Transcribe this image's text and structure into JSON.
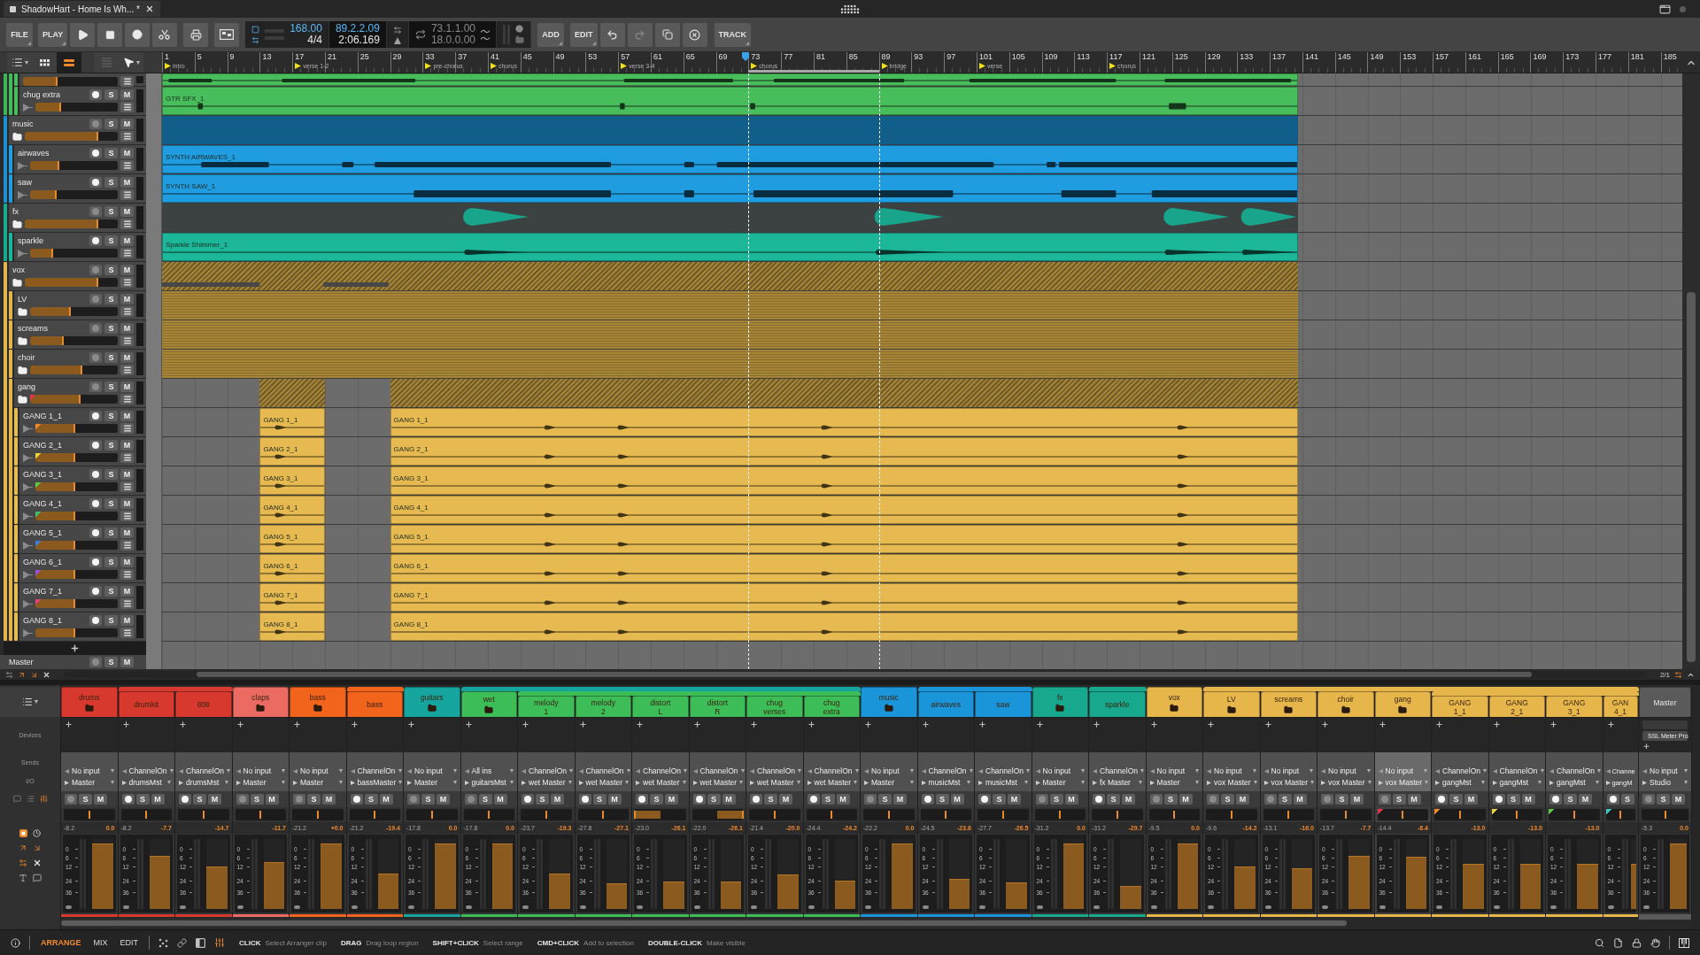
{
  "title_bar": {
    "tab": "ShadowHart - Home Is Wh... *"
  },
  "toolbar": {
    "file": "FILE",
    "play": "PLAY",
    "tempo": "168.00",
    "time_signature": "4/4",
    "position_bars": "89.2.2.09",
    "position_time": "2:06.169",
    "loop_start": "73.1.1.00",
    "loop_length": "18.0.0.00",
    "add": "ADD",
    "edit": "EDIT",
    "track": "TRACK"
  },
  "arranger": {
    "tools": [
      {
        "kind": "list",
        "selected": false
      },
      {
        "kind": "grid",
        "selected": false
      },
      {
        "kind": "lanes",
        "selected": true
      },
      {
        "kind": "stack",
        "selected": false
      },
      {
        "kind": "pointer",
        "selected": false
      }
    ],
    "ruler": [
      {
        "label": "1",
        "marker": "intro",
        "playhead": false,
        "loop": false
      },
      {
        "label": "5",
        "playhead": false,
        "loop": false
      },
      {
        "label": "9",
        "playhead": false,
        "loop": false
      },
      {
        "label": "13",
        "playhead": false,
        "loop": false
      },
      {
        "label": "17",
        "marker": "verse 1-2",
        "playhead": false,
        "loop": false
      },
      {
        "label": "21",
        "playhead": false,
        "loop": false
      },
      {
        "label": "25",
        "playhead": false,
        "loop": false
      },
      {
        "label": "29",
        "playhead": false,
        "loop": false
      },
      {
        "label": "33",
        "marker": "pre-chorus",
        "playhead": false,
        "loop": false
      },
      {
        "label": "37",
        "playhead": false,
        "loop": false
      },
      {
        "label": "41",
        "marker": "chorus",
        "playhead": false,
        "loop": false
      },
      {
        "label": "45",
        "playhead": false,
        "loop": false
      },
      {
        "label": "49",
        "playhead": false,
        "loop": false
      },
      {
        "label": "53",
        "playhead": false,
        "loop": false
      },
      {
        "label": "57",
        "marker": "verse 3-4",
        "playhead": false,
        "loop": false
      },
      {
        "label": "61",
        "playhead": false,
        "loop": false
      },
      {
        "label": "65",
        "playhead": false,
        "loop": false
      },
      {
        "label": "69",
        "playhead": false,
        "loop": false
      },
      {
        "label": "73",
        "marker": "chorus",
        "playhead": true,
        "loop": true
      },
      {
        "label": "77",
        "playhead": false,
        "loop": true
      },
      {
        "label": "81",
        "playhead": false,
        "loop": true
      },
      {
        "label": "85",
        "playhead": false,
        "loop": true
      },
      {
        "label": "89",
        "marker": "bridge",
        "playhead": false,
        "loop": false
      },
      {
        "label": "93",
        "playhead": false,
        "loop": false
      },
      {
        "label": "97",
        "playhead": false,
        "loop": false
      },
      {
        "label": "101",
        "marker": "verse",
        "playhead": false,
        "loop": false
      },
      {
        "label": "105",
        "playhead": false,
        "loop": false
      },
      {
        "label": "109",
        "playhead": false,
        "loop": false
      },
      {
        "label": "113",
        "playhead": false,
        "loop": false
      },
      {
        "label": "117",
        "marker": "chorus",
        "playhead": false,
        "loop": false
      },
      {
        "label": "121",
        "playhead": false,
        "loop": false
      },
      {
        "label": "125",
        "playhead": false,
        "loop": false
      },
      {
        "label": "129",
        "playhead": false,
        "loop": false
      },
      {
        "label": "133",
        "playhead": false,
        "loop": false
      },
      {
        "label": "137",
        "playhead": false,
        "loop": false
      },
      {
        "label": "141",
        "playhead": false,
        "loop": false
      },
      {
        "label": "145",
        "playhead": false,
        "loop": false
      },
      {
        "label": "149",
        "playhead": false,
        "loop": false
      },
      {
        "label": "153",
        "playhead": false,
        "loop": false
      },
      {
        "label": "157",
        "playhead": false,
        "loop": false
      },
      {
        "label": "161",
        "playhead": false,
        "loop": false
      },
      {
        "label": "165",
        "playhead": false,
        "loop": false
      },
      {
        "label": "169",
        "playhead": false,
        "loop": false
      },
      {
        "label": "173",
        "playhead": false,
        "loop": false
      },
      {
        "label": "177",
        "playhead": false,
        "loop": false
      },
      {
        "label": "181",
        "playhead": false,
        "loop": false
      },
      {
        "label": "185",
        "playhead": false,
        "loop": false
      }
    ],
    "tracks": [
      {
        "kind": "group",
        "color": "#3cb556",
        "children": [
          {
            "kind": "group",
            "color": "#43bb58",
            "children": [
              {
                "kind": "cut",
                "color": "#48bd5b",
                "level": 0.36
              },
              {
                "name": "chug extra",
                "kind": "audio",
                "color": "#48bd5b",
                "level": 0.31,
                "buttons": [
                  "S",
                  "M"
                ],
                "clips": [
                  {
                    "name": "GTR SFX_1"
                  }
                ]
              }
            ]
          }
        ]
      },
      {
        "name": "music",
        "kind": "group",
        "color": "#1b8fd2",
        "level": 0.79,
        "buttons": [
          "S",
          "M"
        ],
        "children": [
          {
            "name": "airwaves",
            "kind": "audio",
            "color": "#1f9de0",
            "level": 0.33,
            "buttons": [
              "S",
              "M"
            ],
            "clips": [
              {
                "name": "SYNTH AIRWAVES_1"
              }
            ]
          },
          {
            "name": "saw",
            "kind": "audio",
            "color": "#1f9de0",
            "level": 0.3,
            "buttons": [
              "S",
              "M"
            ],
            "clips": [
              {
                "name": "SYNTH SAW_1"
              }
            ]
          }
        ]
      },
      {
        "name": "fx",
        "kind": "group",
        "color": "#17a98f",
        "level": 0.79,
        "buttons": [
          "S",
          "M"
        ],
        "children": [
          {
            "name": "sparkle",
            "kind": "audio",
            "color": "#1cb799",
            "level": 0.26,
            "buttons": [
              "S",
              "M"
            ],
            "clips": [
              {
                "name": "Sparkle Shimmer_1"
              }
            ]
          }
        ]
      },
      {
        "name": "vox",
        "kind": "group",
        "color": "#e3b64c",
        "level": 0.79,
        "buttons": [
          "S",
          "M"
        ],
        "children": [
          {
            "name": "LV",
            "kind": "group",
            "color": "#e3b64c",
            "level": 0.46,
            "buttons": [
              "S",
              "M"
            ]
          },
          {
            "name": "screams",
            "kind": "group",
            "color": "#e3b64c",
            "level": 0.38,
            "buttons": [
              "S",
              "M"
            ]
          },
          {
            "name": "choir",
            "kind": "group",
            "color": "#e3b64c",
            "level": 0.6,
            "buttons": [
              "S",
              "M"
            ]
          },
          {
            "name": "gang",
            "kind": "group",
            "color": "#e3b64c",
            "level": 0.58,
            "buttons": [
              "S",
              "M"
            ],
            "tag": {
              "color": "#e2354c"
            },
            "children": [
              {
                "name": "GANG 1_1",
                "kind": "audio",
                "color": "#e6ba50",
                "level": 0.48,
                "buttons": [
                  "S",
                  "M"
                ],
                "tag": {
                  "color": "#f08a28"
                },
                "clips": [
                  {
                    "name": "GANG 1_1"
                  },
                  {
                    "name": "GANG 1_1"
                  }
                ]
              },
              {
                "name": "GANG 2_1",
                "kind": "audio",
                "color": "#e6ba50",
                "level": 0.48,
                "buttons": [
                  "S",
                  "M"
                ],
                "tag": {
                  "color": "#e6d43a"
                },
                "clips": [
                  {
                    "name": "GANG 2_1"
                  },
                  {
                    "name": "GANG 2_1"
                  }
                ]
              },
              {
                "name": "GANG 3_1",
                "kind": "audio",
                "color": "#e6ba50",
                "level": 0.48,
                "buttons": [
                  "S",
                  "M"
                ],
                "tag": {
                  "color": "#5cc644"
                },
                "clips": [
                  {
                    "name": "GANG 3_1"
                  },
                  {
                    "name": "GANG 3_1"
                  }
                ]
              },
              {
                "name": "GANG 4_1",
                "kind": "audio",
                "color": "#e6ba50",
                "level": 0.48,
                "buttons": [
                  "S",
                  "M"
                ],
                "tag": {
                  "color": "#38c06a"
                },
                "clips": [
                  {
                    "name": "GANG 4_1"
                  },
                  {
                    "name": "GANG 4_1"
                  }
                ]
              },
              {
                "name": "GANG 5_1",
                "kind": "audio",
                "color": "#e6ba50",
                "level": 0.48,
                "buttons": [
                  "S",
                  "M"
                ],
                "tag": {
                  "color": "#3f7fe0"
                },
                "clips": [
                  {
                    "name": "GANG 5_1"
                  },
                  {
                    "name": "GANG 5_1"
                  }
                ]
              },
              {
                "name": "GANG 6_1",
                "kind": "audio",
                "color": "#e6ba50",
                "level": 0.48,
                "buttons": [
                  "S",
                  "M"
                ],
                "tag": {
                  "color": "#9a4fe0"
                },
                "clips": [
                  {
                    "name": "GANG 6_1"
                  },
                  {
                    "name": "GANG 6_1"
                  }
                ]
              },
              {
                "name": "GANG 7_1",
                "kind": "audio",
                "color": "#e6ba50",
                "level": 0.48,
                "buttons": [
                  "S",
                  "M"
                ],
                "tag": {
                  "color": "#e0407a"
                },
                "clips": [
                  {
                    "name": "GANG 7_1"
                  },
                  {
                    "name": "GANG 7_1"
                  }
                ]
              },
              {
                "name": "GANG 8_1",
                "kind": "audio",
                "color": "#e6ba50",
                "level": 0.48,
                "buttons": [
                  "S",
                  "M"
                ],
                "clips": [
                  {
                    "name": "GANG 8_1"
                  },
                  {
                    "name": "GANG 8_1"
                  }
                ]
              }
            ]
          }
        ]
      }
    ],
    "master": {
      "name": "Master",
      "buttons": [
        "S",
        "M"
      ]
    },
    "zoom_readout": "2/1"
  },
  "mixer": {
    "sections": [
      "Devices",
      "Sends",
      "I/O"
    ],
    "strips": [
      {
        "name": "drums",
        "kind": "group",
        "color": "#d8392e",
        "selected": false,
        "input": "No input",
        "output": "Master",
        "buttons": [
          "S",
          "M"
        ],
        "pan": {
          "level": 0.5
        },
        "volume": "-8.2",
        "peak": "0.0",
        "level": 0.94,
        "scale": [
          "0",
          "6",
          "12",
          "24",
          "36"
        ],
        "children": [
          {
            "name": "drumkit",
            "kind": "audio",
            "color": "#d8392e",
            "selected": false,
            "input": "ChannelOn",
            "output": "drumsMst",
            "buttons": [
              "S",
              "M"
            ],
            "pan": {
              "level": 0.5
            },
            "volume": "-8.2",
            "peak": "-7.7",
            "level": 0.76,
            "scale": [
              "0",
              "6",
              "12",
              "24",
              "36"
            ]
          },
          {
            "name": "808",
            "kind": "audio",
            "color": "#d8392e",
            "selected": false,
            "input": "ChannelOn",
            "output": "drumsMst",
            "buttons": [
              "S",
              "M"
            ],
            "pan": {
              "level": 0.5
            },
            "peak": "-14.7",
            "level": 0.61,
            "scale": [
              "0",
              "6",
              "12",
              "24",
              "36"
            ]
          }
        ]
      },
      {
        "name": "claps",
        "kind": "group",
        "color": "#eb6b62",
        "selected": false,
        "input": "No input",
        "output": "Master",
        "buttons": [
          "S",
          "M"
        ],
        "pan": {
          "level": 0.5
        },
        "peak": "-11.7",
        "level": 0.67,
        "scale": [
          "0",
          "6",
          "12",
          "24",
          "36"
        ]
      },
      {
        "name": "bass",
        "kind": "group",
        "color": "#f2631b",
        "selected": false,
        "input": "No input",
        "output": "Master",
        "buttons": [
          "S",
          "M"
        ],
        "pan": {
          "level": 0.5
        },
        "volume": "-21.2",
        "peak": "+0.0",
        "level": 0.94,
        "scale": [
          "0",
          "6",
          "12",
          "24",
          "36"
        ],
        "children": [
          {
            "name": "bass",
            "kind": "audio",
            "color": "#f2631b",
            "selected": false,
            "input": "ChannelOn",
            "output": "bassMaster",
            "buttons": [
              "S",
              "M"
            ],
            "pan": {
              "level": 0.5
            },
            "volume": "-21.2",
            "peak": "-19.4",
            "level": 0.51,
            "scale": [
              "0",
              "6",
              "12",
              "24",
              "36"
            ]
          }
        ]
      },
      {
        "name": "guitars",
        "kind": "group",
        "color": "#16a59e",
        "selected": false,
        "input": "No input",
        "output": "Master",
        "buttons": [
          "S",
          "M"
        ],
        "pan": {
          "level": 0.5
        },
        "volume": "-17.8",
        "peak": "0.0",
        "level": 0.94,
        "scale": [
          "0",
          "6",
          "12",
          "24",
          "36"
        ],
        "children": [
          {
            "name": "wet",
            "kind": "group",
            "color": "#3dbd58",
            "selected": false,
            "input": "All ins",
            "output": "guitarsMst",
            "buttons": [
              "S",
              "M"
            ],
            "pan": {
              "level": 0.5
            },
            "volume": "-17.8",
            "peak": "0.0",
            "level": 0.94,
            "scale": [
              "0",
              "6",
              "12",
              "24",
              "36"
            ],
            "children": [
              {
                "name": "melody 1",
                "kind": "audio",
                "color": "#3dbd58",
                "selected": false,
                "input": "ChannelOn",
                "output": "wet Master",
                "buttons": [
                  "S",
                  "M"
                ],
                "pan": {
                  "level": 0.5
                },
                "volume": "-23.7",
                "peak": "-19.3",
                "level": 0.51,
                "scale": [
                  "0",
                  "6",
                  "12",
                  "24",
                  "36"
                ]
              },
              {
                "name": "melody 2",
                "kind": "audio",
                "color": "#3dbd58",
                "selected": false,
                "input": "ChannelOn",
                "output": "wet Master",
                "buttons": [
                  "S",
                  "M"
                ],
                "pan": {
                  "level": 0.5
                },
                "volume": "-27.8",
                "peak": "-27.1",
                "level": 0.37,
                "scale": [
                  "0",
                  "6",
                  "12",
                  "24",
                  "36"
                ]
              },
              {
                "name": "distort L",
                "kind": "audio",
                "color": "#3dbd58",
                "selected": false,
                "input": "ChannelOn",
                "output": "wet Master",
                "buttons": [
                  "S",
                  "M"
                ],
                "pan": {
                  "level": 0.0
                },
                "volume": "-23.0",
                "peak": "-26.1",
                "level": 0.39,
                "scale": [
                  "0",
                  "6",
                  "12",
                  "24",
                  "36"
                ]
              },
              {
                "name": "distort R",
                "kind": "audio",
                "color": "#3dbd58",
                "selected": false,
                "input": "ChannelOn",
                "output": "wet Master",
                "buttons": [
                  "S",
                  "M"
                ],
                "pan": {
                  "level": 1.0
                },
                "volume": "-22.0",
                "peak": "-26.1",
                "level": 0.39,
                "scale": [
                  "0",
                  "6",
                  "12",
                  "24",
                  "36"
                ]
              },
              {
                "name": "chug verses",
                "kind": "audio",
                "color": "#3dbd58",
                "selected": false,
                "input": "ChannelOn",
                "output": "wet Master",
                "buttons": [
                  "S",
                  "M"
                ],
                "pan": {
                  "level": 0.5
                },
                "volume": "-21.4",
                "peak": "-20.0",
                "level": 0.5,
                "scale": [
                  "0",
                  "6",
                  "12",
                  "24",
                  "36"
                ]
              },
              {
                "name": "chug extra",
                "kind": "audio",
                "color": "#3dbd58",
                "selected": false,
                "input": "ChannelOn",
                "output": "wet Master",
                "buttons": [
                  "S",
                  "M"
                ],
                "pan": {
                  "level": 0.5
                },
                "volume": "-24.4",
                "peak": "-24.2",
                "level": 0.41,
                "scale": [
                  "0",
                  "6",
                  "12",
                  "24",
                  "36"
                ]
              }
            ]
          }
        ]
      },
      {
        "name": "music",
        "kind": "group",
        "color": "#1b95d9",
        "selected": false,
        "input": "No input",
        "output": "Master",
        "buttons": [
          "S",
          "M"
        ],
        "pan": {
          "level": 0.5
        },
        "volume": "-22.2",
        "peak": "0.0",
        "level": 0.94,
        "scale": [
          "0",
          "6",
          "12",
          "24",
          "36"
        ],
        "children": [
          {
            "name": "airwaves",
            "kind": "audio",
            "color": "#1b95d9",
            "selected": false,
            "input": "ChannelOn",
            "output": "musicMst",
            "buttons": [
              "S",
              "M"
            ],
            "pan": {
              "level": 0.5
            },
            "volume": "-24.5",
            "peak": "-23.6",
            "level": 0.43,
            "scale": [
              "0",
              "6",
              "12",
              "24",
              "36"
            ]
          },
          {
            "name": "saw",
            "kind": "audio",
            "color": "#1b95d9",
            "selected": false,
            "input": "ChannelOn",
            "output": "musicMst",
            "buttons": [
              "S",
              "M"
            ],
            "pan": {
              "level": 0.5
            },
            "volume": "-27.7",
            "peak": "-26.5",
            "level": 0.38,
            "scale": [
              "0",
              "6",
              "12",
              "24",
              "36"
            ]
          }
        ]
      },
      {
        "name": "fx",
        "kind": "group",
        "color": "#17a88d",
        "selected": false,
        "input": "No input",
        "output": "Master",
        "buttons": [
          "S",
          "M"
        ],
        "pan": {
          "level": 0.5
        },
        "volume": "-31.2",
        "peak": "0.0",
        "level": 0.94,
        "scale": [
          "0",
          "6",
          "12",
          "24",
          "36"
        ],
        "children": [
          {
            "name": "sparkle",
            "kind": "audio",
            "color": "#17a88d",
            "selected": false,
            "input": "ChannelOn",
            "output": "fx Master",
            "buttons": [
              "S",
              "M"
            ],
            "pan": {
              "level": 0.5
            },
            "volume": "-31.2",
            "peak": "-29.7",
            "level": 0.33,
            "scale": [
              "0",
              "6",
              "12",
              "24",
              "36"
            ]
          }
        ]
      },
      {
        "name": "vox",
        "kind": "group",
        "color": "#e6b64b",
        "selected": false,
        "input": "No input",
        "output": "Master",
        "buttons": [
          "S",
          "M"
        ],
        "pan": {
          "level": 0.5
        },
        "volume": "-9.5",
        "peak": "0.0",
        "level": 0.94,
        "scale": [
          "0",
          "6",
          "12",
          "24",
          "36"
        ],
        "children": [
          {
            "name": "LV",
            "kind": "group",
            "color": "#e6b64b",
            "selected": false,
            "input": "No input",
            "output": "vox Master",
            "buttons": [
              "S",
              "M"
            ],
            "pan": {
              "level": 0.5
            },
            "volume": "-9.6",
            "peak": "-14.2",
            "level": 0.61,
            "scale": [
              "0",
              "6",
              "12",
              "24",
              "36"
            ]
          },
          {
            "name": "screams",
            "kind": "group",
            "color": "#e6b64b",
            "selected": false,
            "input": "No input",
            "output": "vox Master",
            "buttons": [
              "S",
              "M"
            ],
            "pan": {
              "level": 0.5
            },
            "volume": "-13.1",
            "peak": "-16.0",
            "level": 0.58,
            "scale": [
              "0",
              "6",
              "12",
              "24",
              "36"
            ]
          },
          {
            "name": "choir",
            "kind": "group",
            "color": "#e6b64b",
            "selected": false,
            "input": "No input",
            "output": "vox Master",
            "buttons": [
              "S",
              "M"
            ],
            "pan": {
              "level": 0.5
            },
            "volume": "-13.7",
            "peak": "-7.7",
            "level": 0.76,
            "scale": [
              "0",
              "6",
              "12",
              "24",
              "36"
            ]
          },
          {
            "name": "gang",
            "kind": "group",
            "color": "#e6b64b",
            "selected": true,
            "input": "No input",
            "output": "vox Master",
            "buttons": [
              "S",
              "M"
            ],
            "pan": {
              "level": 0.5
            },
            "volume": "-14.4",
            "peak": "-8.4",
            "level": 0.75,
            "scale": [
              "0",
              "6",
              "12",
              "24",
              "36"
            ],
            "tag": {
              "color": "#e2354c"
            },
            "children": [
              {
                "name": "GANG 1_1",
                "kind": "audio",
                "color": "#e6b64b",
                "selected": false,
                "input": "ChannelOn",
                "output": "gangMst",
                "buttons": [
                  "S",
                  "M"
                ],
                "pan": {
                  "level": 0.5
                },
                "peak": "-13.0",
                "level": 0.64,
                "scale": [
                  "0",
                  "6",
                  "12",
                  "24",
                  "36"
                ],
                "tag": {
                  "color": "#f08a28"
                }
              },
              {
                "name": "GANG 2_1",
                "kind": "audio",
                "color": "#e6b64b",
                "selected": false,
                "input": "ChannelOn",
                "output": "gangMst",
                "buttons": [
                  "S",
                  "M"
                ],
                "pan": {
                  "level": 0.5
                },
                "peak": "-13.0",
                "level": 0.64,
                "scale": [
                  "0",
                  "6",
                  "12",
                  "24",
                  "36"
                ],
                "tag": {
                  "color": "#e6d43a"
                }
              },
              {
                "name": "GANG 3_1",
                "kind": "audio",
                "color": "#e6b64b",
                "selected": false,
                "input": "ChannelOn",
                "output": "gangMst",
                "buttons": [
                  "S",
                  "M"
                ],
                "pan": {
                  "level": 0.5
                },
                "peak": "-13.0",
                "level": 0.64,
                "scale": [
                  "0",
                  "6",
                  "12",
                  "24",
                  "36"
                ],
                "tag": {
                  "color": "#5cc644"
                }
              },
              {
                "name": "GAN 4_1",
                "kind": "cut",
                "color": "#e6b64b",
                "selected": false,
                "input": "Channe",
                "output": "gangM",
                "buttons": [
                  "S"
                ],
                "pan": {
                  "level": 0.5
                },
                "level": 0.64,
                "scale": [
                  "0",
                  "6",
                  "12",
                  "24",
                  "36"
                ],
                "tag": {
                  "color": "#38c6c0"
                }
              }
            ]
          }
        ]
      }
    ],
    "master": {
      "name": "Master",
      "devices": [
        {
          "enabled": false
        },
        {
          "name": "SSL Meter Pro",
          "enabled": true
        }
      ],
      "input": "No input",
      "output": "Studio",
      "buttons": [
        "S",
        "M"
      ],
      "pan": {
        "level": 0.5
      },
      "volume": "-5.3",
      "peak": "0.0",
      "level": 0.94,
      "scale": [
        "0",
        "6",
        "12",
        "24",
        "36"
      ]
    }
  },
  "status_bar": {
    "tabs": [
      {
        "label": "ARRANGE",
        "selected": true
      },
      {
        "label": "MIX",
        "selected": false
      },
      {
        "label": "EDIT",
        "selected": false
      }
    ],
    "toggles": [
      {
        "kind": "dots",
        "on": false
      },
      {
        "kind": "link",
        "on": false
      },
      {
        "kind": "panel",
        "on": false
      },
      {
        "kind": "mixer",
        "on": true
      }
    ],
    "hints": [
      {
        "key": "CLICK",
        "action": "Select Arranger clip"
      },
      {
        "key": "DRAG",
        "action": "Drag loop region"
      },
      {
        "key": "SHIFT+CLICK",
        "action": "Select range"
      },
      {
        "key": "CMD+CLICK",
        "action": "Add to selection"
      },
      {
        "key": "DOUBLE-CLICK",
        "action": "Make visible"
      }
    ]
  }
}
